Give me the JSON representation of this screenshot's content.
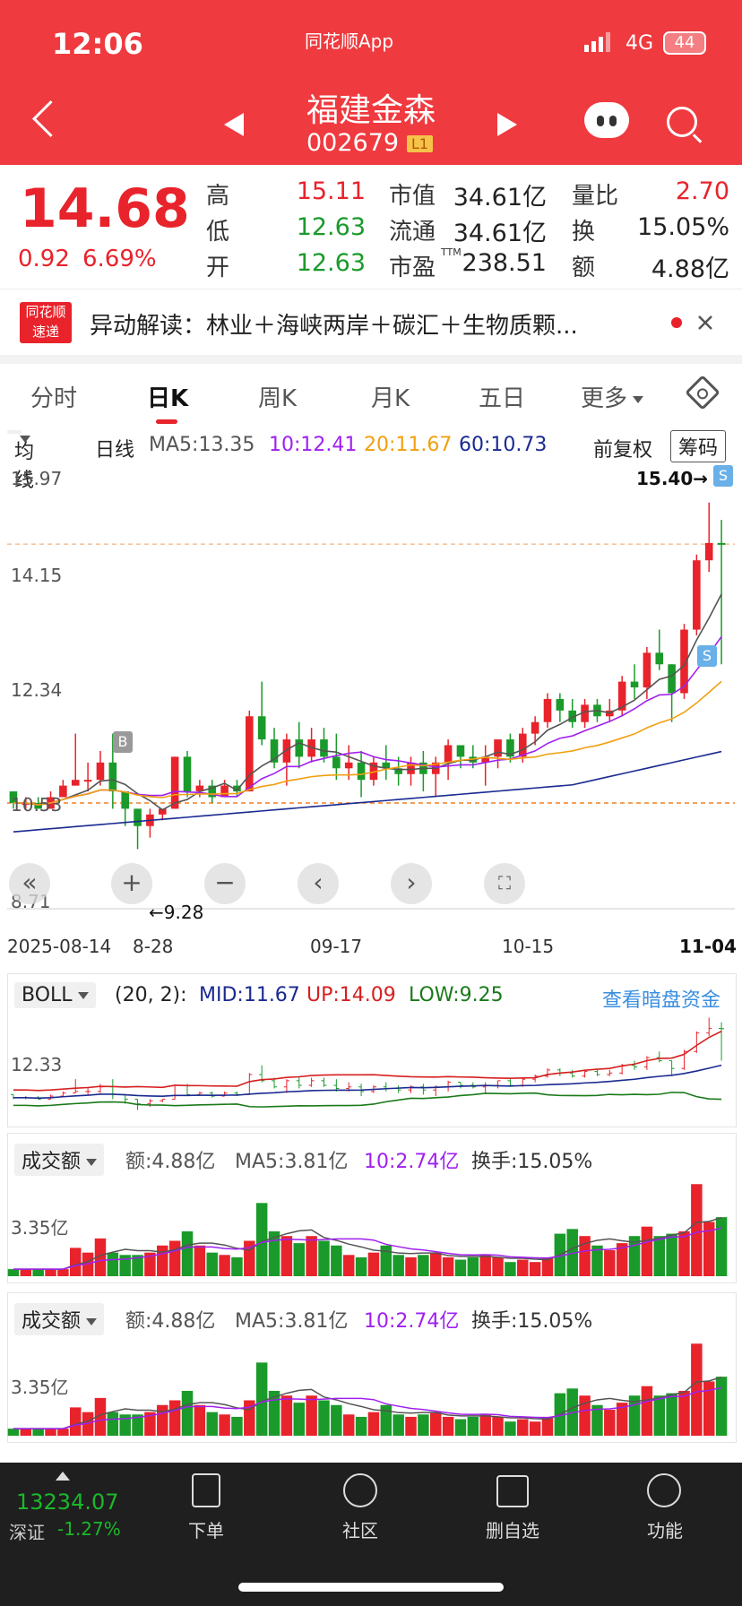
{
  "status": {
    "time": "12:06",
    "app": "同花顺App",
    "network": "4G",
    "battery": "44"
  },
  "header": {
    "name": "福建金森",
    "code": "002679",
    "level": "L1"
  },
  "quote": {
    "price": "14.68",
    "change": "0.92",
    "change_pct": "6.69%",
    "high_label": "高",
    "high": "15.11",
    "low_label": "低",
    "low": "12.63",
    "open_label": "开",
    "open": "12.63",
    "mktcap_label": "市值",
    "mktcap": "34.61亿",
    "float_label": "流通",
    "float": "34.61亿",
    "pe_label": "市盈",
    "pe_sup": "TTM",
    "pe": "238.51",
    "volratio_label": "量比",
    "volratio": "2.70",
    "turnover_label": "换",
    "turnover": "15.05%",
    "amount_label": "额",
    "amount": "4.88亿"
  },
  "news": {
    "logo": "同花顺速递",
    "text": "异动解读：林业＋海峡两岸＋碳汇＋生物质颗..."
  },
  "tabs": [
    "分时",
    "日K",
    "周K",
    "月K",
    "五日",
    "更多"
  ],
  "active_tab": "日K",
  "ma": {
    "selector": "均线",
    "period": "日线",
    "ma5": "MA5:13.35",
    "ma10": "10:12.41",
    "ma20": "20:11.67",
    "ma60": "60:10.73",
    "adj": "前复权",
    "chip": "筹码"
  },
  "kline": {
    "y_labels": [
      "15.97",
      "14.15",
      "12.34",
      "10.53",
      "8.71"
    ],
    "dates": [
      "2025-08-14",
      "8-28",
      "09-17",
      "10-15",
      "11-04"
    ],
    "max_annot": "15.40→",
    "min_annot": "←9.28",
    "badge_buy": "B",
    "badge_sell": "S"
  },
  "boll": {
    "name": "BOLL",
    "params": "(20, 2):",
    "mid": "MID:11.67",
    "up": "UP:14.09",
    "low": "LOW:9.25",
    "link": "查看暗盘资金",
    "y_label": "12.33"
  },
  "vol1": {
    "name": "成交额",
    "amt": "额:4.88亿",
    "ma5": "MA5:3.81亿",
    "ma10": "10:2.74亿",
    "turnover": "换手:15.05%",
    "y_label": "3.35亿"
  },
  "vol2": {
    "name": "成交额",
    "amt": "额:4.88亿",
    "ma5": "MA5:3.81亿",
    "ma10": "10:2.74亿",
    "turnover": "换手:15.05%",
    "y_label": "3.35亿"
  },
  "nav": {
    "index_value": "13234.07",
    "index_name": "深证",
    "index_change": "-1.27%",
    "items": [
      "下单",
      "社区",
      "删自选",
      "功能"
    ]
  },
  "chart_data": [
    {
      "type": "candlestick",
      "title": "",
      "ylim": [
        8.71,
        15.97
      ],
      "series": [
        {
          "values": [
            [
              10.4,
              10.4,
              10.1,
              10.2
            ],
            [
              10.2,
              10.3,
              10.1,
              10.2
            ],
            [
              10.2,
              10.3,
              10.1,
              10.1
            ],
            [
              10.1,
              10.4,
              10.1,
              10.3
            ],
            [
              10.3,
              10.6,
              10.3,
              10.5
            ],
            [
              10.5,
              11.4,
              10.5,
              10.6
            ],
            [
              10.6,
              10.9,
              10.4,
              10.6
            ],
            [
              10.6,
              11.1,
              10.5,
              10.9
            ],
            [
              10.9,
              11.4,
              10.1,
              10.4
            ],
            [
              10.4,
              10.4,
              9.8,
              10.1
            ],
            [
              10.1,
              10.1,
              9.4,
              9.8
            ],
            [
              9.8,
              10.1,
              9.6,
              10.0
            ],
            [
              10.0,
              10.1,
              9.9,
              10.1
            ],
            [
              10.1,
              11.0,
              10.1,
              11.0
            ],
            [
              11.0,
              11.1,
              10.3,
              10.4
            ],
            [
              10.4,
              10.6,
              10.3,
              10.5
            ],
            [
              10.5,
              10.6,
              10.2,
              10.3
            ],
            [
              10.3,
              10.6,
              10.3,
              10.5
            ],
            [
              10.5,
              10.6,
              10.3,
              10.4
            ],
            [
              10.4,
              11.8,
              10.4,
              11.7
            ],
            [
              11.7,
              12.3,
              11.2,
              11.3
            ],
            [
              11.3,
              11.5,
              10.8,
              10.9
            ],
            [
              10.9,
              11.4,
              10.5,
              11.3
            ],
            [
              11.3,
              11.6,
              10.8,
              11.0
            ],
            [
              11.0,
              11.5,
              10.9,
              11.3
            ],
            [
              11.3,
              11.5,
              10.9,
              11.0
            ],
            [
              11.0,
              11.4,
              10.6,
              10.8
            ],
            [
              10.8,
              11.2,
              10.6,
              10.9
            ],
            [
              10.9,
              11.1,
              10.3,
              10.6
            ],
            [
              10.6,
              11.0,
              10.5,
              10.9
            ],
            [
              10.9,
              11.2,
              10.6,
              10.8
            ],
            [
              10.8,
              11.0,
              10.5,
              10.7
            ],
            [
              10.7,
              11.0,
              10.5,
              10.9
            ],
            [
              10.9,
              11.1,
              10.4,
              10.7
            ],
            [
              10.7,
              11.0,
              10.3,
              10.9
            ],
            [
              10.9,
              11.3,
              10.6,
              11.2
            ],
            [
              11.2,
              11.2,
              10.8,
              11.0
            ],
            [
              11.0,
              11.2,
              10.8,
              10.9
            ],
            [
              10.9,
              11.2,
              10.5,
              11.0
            ],
            [
              11.0,
              11.3,
              10.8,
              11.3
            ],
            [
              11.3,
              11.4,
              10.9,
              11.0
            ],
            [
              11.0,
              11.5,
              10.9,
              11.4
            ],
            [
              11.4,
              11.7,
              11.2,
              11.6
            ],
            [
              11.6,
              12.1,
              11.5,
              12.0
            ],
            [
              12.0,
              12.1,
              11.6,
              11.8
            ],
            [
              11.8,
              12.0,
              11.5,
              11.6
            ],
            [
              11.6,
              12.0,
              11.5,
              11.9
            ],
            [
              11.9,
              12.0,
              11.6,
              11.7
            ],
            [
              11.7,
              12.0,
              11.6,
              11.8
            ],
            [
              11.8,
              12.4,
              11.7,
              12.3
            ],
            [
              12.3,
              12.6,
              12.0,
              12.2
            ],
            [
              12.2,
              12.9,
              12.0,
              12.8
            ],
            [
              12.8,
              13.2,
              12.5,
              12.6
            ],
            [
              12.6,
              12.6,
              11.6,
              12.1
            ],
            [
              12.1,
              13.3,
              12.0,
              13.2
            ],
            [
              13.2,
              14.5,
              13.1,
              14.4
            ],
            [
              14.4,
              15.4,
              14.2,
              14.7
            ],
            [
              14.7,
              15.1,
              12.6,
              14.68
            ]
          ]
        }
      ]
    },
    {
      "type": "line",
      "title": "BOLL (20, 2)",
      "series": [
        {
          "name": "MID",
          "values": [
            11.67
          ]
        },
        {
          "name": "UP",
          "values": [
            14.09
          ]
        },
        {
          "name": "LOW",
          "values": [
            9.25
          ]
        }
      ]
    },
    {
      "type": "bar",
      "title": "成交额",
      "unit": "亿",
      "values": [
        0.3,
        0.3,
        0.3,
        0.3,
        0.3,
        1.2,
        1.0,
        1.6,
        1.0,
        0.9,
        0.9,
        1.0,
        1.3,
        1.5,
        1.9,
        1.3,
        1.0,
        0.9,
        0.8,
        1.5,
        3.1,
        1.9,
        1.7,
        1.4,
        1.7,
        1.5,
        1.3,
        0.9,
        0.8,
        1.0,
        1.3,
        0.9,
        0.8,
        0.9,
        1.0,
        0.8,
        0.7,
        0.8,
        0.9,
        0.8,
        0.6,
        0.7,
        0.6,
        0.8,
        1.8,
        2.0,
        1.7,
        1.3,
        1.1,
        1.4,
        1.7,
        2.1,
        1.7,
        1.8,
        1.9,
        3.9,
        2.3,
        2.5
      ]
    }
  ]
}
